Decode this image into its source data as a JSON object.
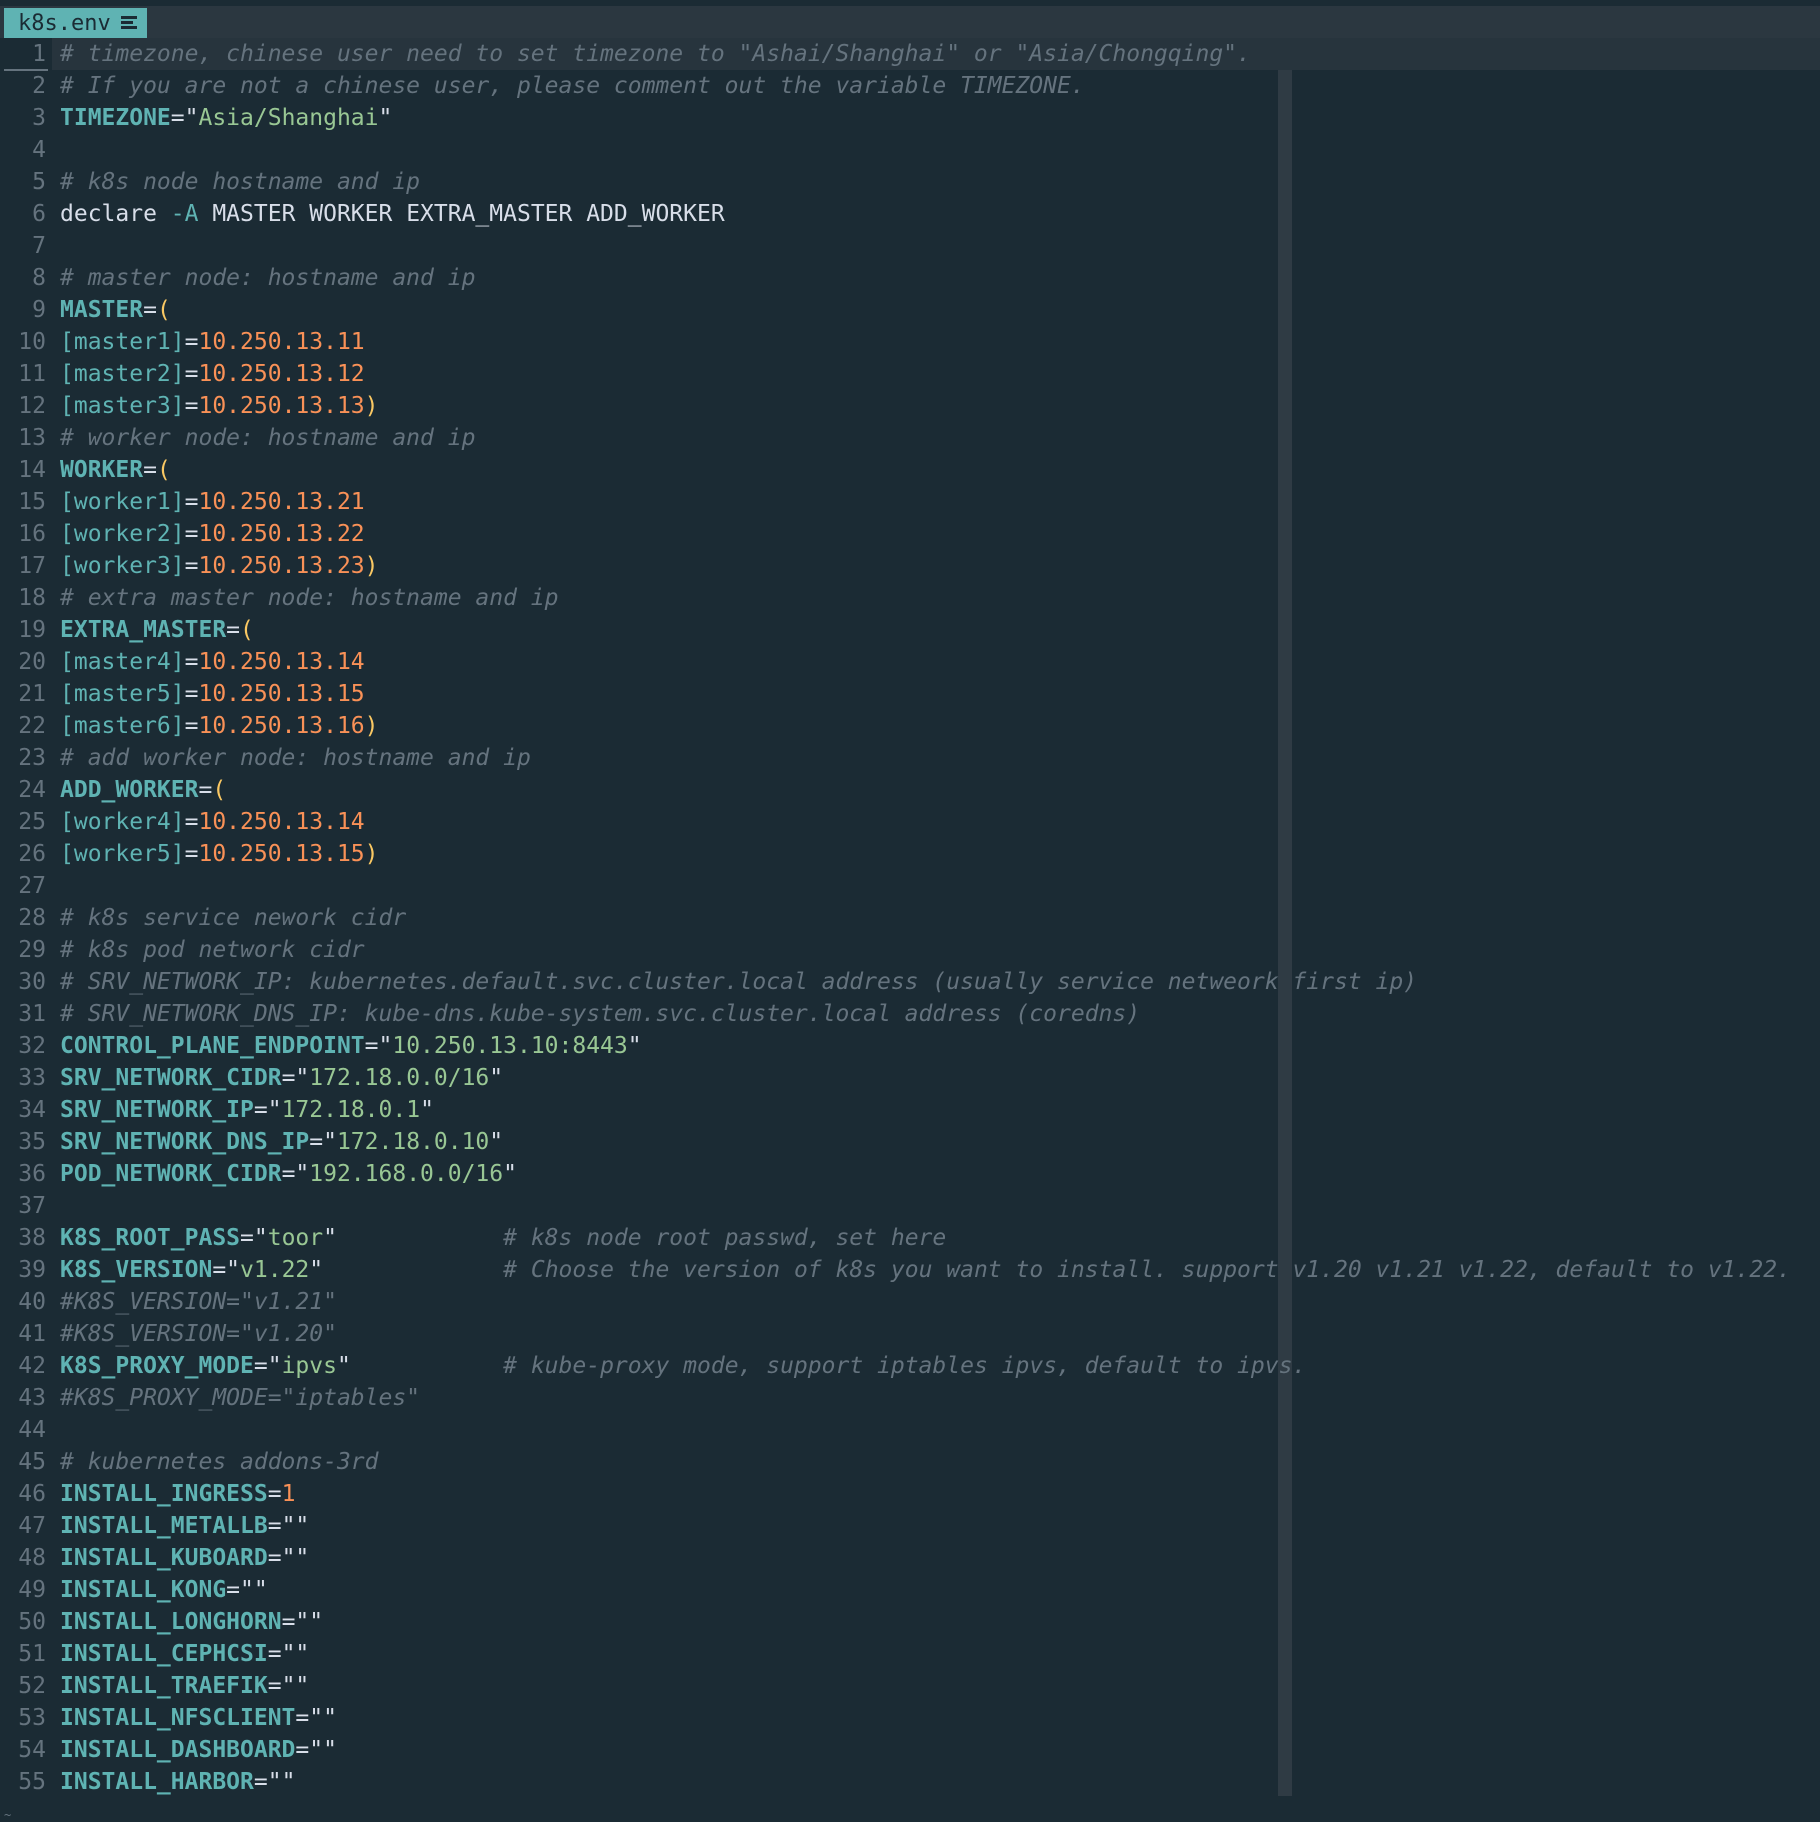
{
  "tab": {
    "filename": "k8s.env",
    "icon": "list-icon"
  },
  "colors": {
    "background": "#1b2b34",
    "comment": "#65737e",
    "keyword": "#5fb3b3",
    "string": "#99c794",
    "number": "#f99157",
    "bracket": "#fac863",
    "tab_bg": "#5fb3b3"
  },
  "lines": [
    [
      [
        "c",
        "# timezone, chinese user need to set timezone to \"Ashai/Shanghai\" or \"Asia/Chongqing\"."
      ]
    ],
    [
      [
        "c",
        "# If you are not a chinese user, please comment out the variable TIMEZONE."
      ]
    ],
    [
      [
        "k",
        "TIMEZONE"
      ],
      [
        "t",
        "=\""
      ],
      [
        "s",
        "Asia/Shanghai"
      ],
      [
        "t",
        "\""
      ]
    ],
    [],
    [
      [
        "c",
        "# k8s node hostname and ip"
      ]
    ],
    [
      [
        "t",
        "declare "
      ],
      [
        "i",
        "-A"
      ],
      [
        "t",
        " MASTER WORKER EXTRA_MASTER ADD_WORKER"
      ]
    ],
    [],
    [
      [
        "c",
        "# master node: hostname and ip"
      ]
    ],
    [
      [
        "k",
        "MASTER"
      ],
      [
        "t",
        "="
      ],
      [
        "b",
        "("
      ]
    ],
    [
      [
        "i",
        "[master1]"
      ],
      [
        "t",
        "="
      ],
      [
        "n",
        "10.250.13.11"
      ]
    ],
    [
      [
        "i",
        "[master2]"
      ],
      [
        "t",
        "="
      ],
      [
        "n",
        "10.250.13.12"
      ]
    ],
    [
      [
        "i",
        "[master3]"
      ],
      [
        "t",
        "="
      ],
      [
        "n",
        "10.250.13.13"
      ],
      [
        "b",
        ")"
      ]
    ],
    [
      [
        "c",
        "# worker node: hostname and ip"
      ]
    ],
    [
      [
        "k",
        "WORKER"
      ],
      [
        "t",
        "="
      ],
      [
        "b",
        "("
      ]
    ],
    [
      [
        "i",
        "[worker1]"
      ],
      [
        "t",
        "="
      ],
      [
        "n",
        "10.250.13.21"
      ]
    ],
    [
      [
        "i",
        "[worker2]"
      ],
      [
        "t",
        "="
      ],
      [
        "n",
        "10.250.13.22"
      ]
    ],
    [
      [
        "i",
        "[worker3]"
      ],
      [
        "t",
        "="
      ],
      [
        "n",
        "10.250.13.23"
      ],
      [
        "b",
        ")"
      ]
    ],
    [
      [
        "c",
        "# extra master node: hostname and ip"
      ]
    ],
    [
      [
        "k",
        "EXTRA_MASTER"
      ],
      [
        "t",
        "="
      ],
      [
        "b",
        "("
      ]
    ],
    [
      [
        "i",
        "[master4]"
      ],
      [
        "t",
        "="
      ],
      [
        "n",
        "10.250.13.14"
      ]
    ],
    [
      [
        "i",
        "[master5]"
      ],
      [
        "t",
        "="
      ],
      [
        "n",
        "10.250.13.15"
      ]
    ],
    [
      [
        "i",
        "[master6]"
      ],
      [
        "t",
        "="
      ],
      [
        "n",
        "10.250.13.16"
      ],
      [
        "b",
        ")"
      ]
    ],
    [
      [
        "c",
        "# add worker node: hostname and ip"
      ]
    ],
    [
      [
        "k",
        "ADD_WORKER"
      ],
      [
        "t",
        "="
      ],
      [
        "b",
        "("
      ]
    ],
    [
      [
        "i",
        "[worker4]"
      ],
      [
        "t",
        "="
      ],
      [
        "n",
        "10.250.13.14"
      ]
    ],
    [
      [
        "i",
        "[worker5]"
      ],
      [
        "t",
        "="
      ],
      [
        "n",
        "10.250.13.15"
      ],
      [
        "b",
        ")"
      ]
    ],
    [],
    [
      [
        "c",
        "# k8s service nework cidr"
      ]
    ],
    [
      [
        "c",
        "# k8s pod network cidr"
      ]
    ],
    [
      [
        "c",
        "# SRV_NETWORK_IP: kubernetes.default.svc.cluster.local address (usually service netweork first ip)"
      ]
    ],
    [
      [
        "c",
        "# SRV_NETWORK_DNS_IP: kube-dns.kube-system.svc.cluster.local address (coredns)"
      ]
    ],
    [
      [
        "k",
        "CONTROL_PLANE_ENDPOINT"
      ],
      [
        "t",
        "=\""
      ],
      [
        "s",
        "10.250.13.10:8443"
      ],
      [
        "t",
        "\""
      ]
    ],
    [
      [
        "k",
        "SRV_NETWORK_CIDR"
      ],
      [
        "t",
        "=\""
      ],
      [
        "s",
        "172.18.0.0/16"
      ],
      [
        "t",
        "\""
      ]
    ],
    [
      [
        "k",
        "SRV_NETWORK_IP"
      ],
      [
        "t",
        "=\""
      ],
      [
        "s",
        "172.18.0.1"
      ],
      [
        "t",
        "\""
      ]
    ],
    [
      [
        "k",
        "SRV_NETWORK_DNS_IP"
      ],
      [
        "t",
        "=\""
      ],
      [
        "s",
        "172.18.0.10"
      ],
      [
        "t",
        "\""
      ]
    ],
    [
      [
        "k",
        "POD_NETWORK_CIDR"
      ],
      [
        "t",
        "=\""
      ],
      [
        "s",
        "192.168.0.0/16"
      ],
      [
        "t",
        "\""
      ]
    ],
    [],
    [
      [
        "k",
        "K8S_ROOT_PASS"
      ],
      [
        "t",
        "=\""
      ],
      [
        "s",
        "toor"
      ],
      [
        "t",
        "\"            "
      ],
      [
        "c",
        "# k8s node root passwd, set here"
      ]
    ],
    [
      [
        "k",
        "K8S_VERSION"
      ],
      [
        "t",
        "=\""
      ],
      [
        "s",
        "v1.22"
      ],
      [
        "t",
        "\"             "
      ],
      [
        "c",
        "# Choose the version of k8s you want to install. support v1.20 v1.21 v1.22, default to v1.22."
      ]
    ],
    [
      [
        "c",
        "#K8S_VERSION=\"v1.21\""
      ]
    ],
    [
      [
        "c",
        "#K8S_VERSION=\"v1.20\""
      ]
    ],
    [
      [
        "k",
        "K8S_PROXY_MODE"
      ],
      [
        "t",
        "=\""
      ],
      [
        "s",
        "ipvs"
      ],
      [
        "t",
        "\"           "
      ],
      [
        "c",
        "# kube-proxy mode, support iptables ipvs, default to ipvs."
      ]
    ],
    [
      [
        "c",
        "#K8S_PROXY_MODE=\"iptables\""
      ]
    ],
    [],
    [
      [
        "c",
        "# kubernetes addons-3rd"
      ]
    ],
    [
      [
        "k",
        "INSTALL_INGRESS"
      ],
      [
        "t",
        "="
      ],
      [
        "n",
        "1"
      ]
    ],
    [
      [
        "k",
        "INSTALL_METALLB"
      ],
      [
        "t",
        "=\"\""
      ]
    ],
    [
      [
        "k",
        "INSTALL_KUBOARD"
      ],
      [
        "t",
        "=\"\""
      ]
    ],
    [
      [
        "k",
        "INSTALL_KONG"
      ],
      [
        "t",
        "=\"\""
      ]
    ],
    [
      [
        "k",
        "INSTALL_LONGHORN"
      ],
      [
        "t",
        "=\"\""
      ]
    ],
    [
      [
        "k",
        "INSTALL_CEPHCSI"
      ],
      [
        "t",
        "=\"\""
      ]
    ],
    [
      [
        "k",
        "INSTALL_TRAEFIK"
      ],
      [
        "t",
        "=\"\""
      ]
    ],
    [
      [
        "k",
        "INSTALL_NFSCLIENT"
      ],
      [
        "t",
        "=\"\""
      ]
    ],
    [
      [
        "k",
        "INSTALL_DASHBOARD"
      ],
      [
        "t",
        "=\"\""
      ]
    ],
    [
      [
        "k",
        "INSTALL_HARBOR"
      ],
      [
        "t",
        "=\"\""
      ]
    ]
  ]
}
